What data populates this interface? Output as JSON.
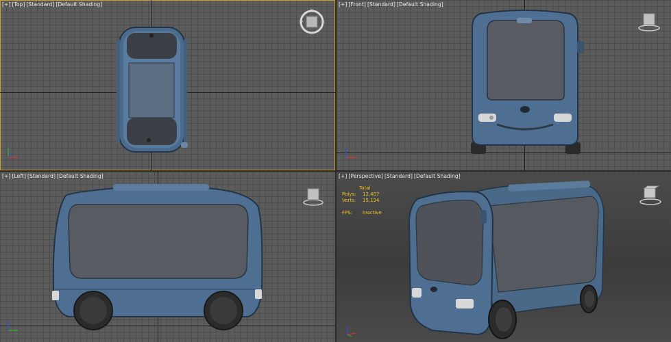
{
  "viewports": {
    "top": {
      "label": [
        "[+]",
        "[Top]",
        "[Standard]",
        "[Default Shading]"
      ],
      "compass": {
        "n": "N",
        "w": "W",
        "e": "E"
      }
    },
    "front": {
      "label": [
        "[+]",
        "[Front]",
        "[Standard]",
        "[Default Shading]"
      ]
    },
    "left": {
      "label": [
        "[+]",
        "[Left]",
        "[Standard]",
        "[Default Shading]"
      ]
    },
    "perspective": {
      "label": [
        "[+]",
        "[Perspective]",
        "[Standard]",
        "[Default Shading]"
      ],
      "stats": {
        "header": "Total",
        "polys_label": "Polys:",
        "polys_value": "12,407",
        "verts_label": "Verts:",
        "verts_value": "15,194",
        "fps_label": "FPS:",
        "fps_value": "Inactive"
      }
    }
  },
  "colors": {
    "active_border": "#c8a030",
    "stats_text": "#f0c419",
    "model_body": "#4f6f92",
    "glass": "#555a60"
  }
}
